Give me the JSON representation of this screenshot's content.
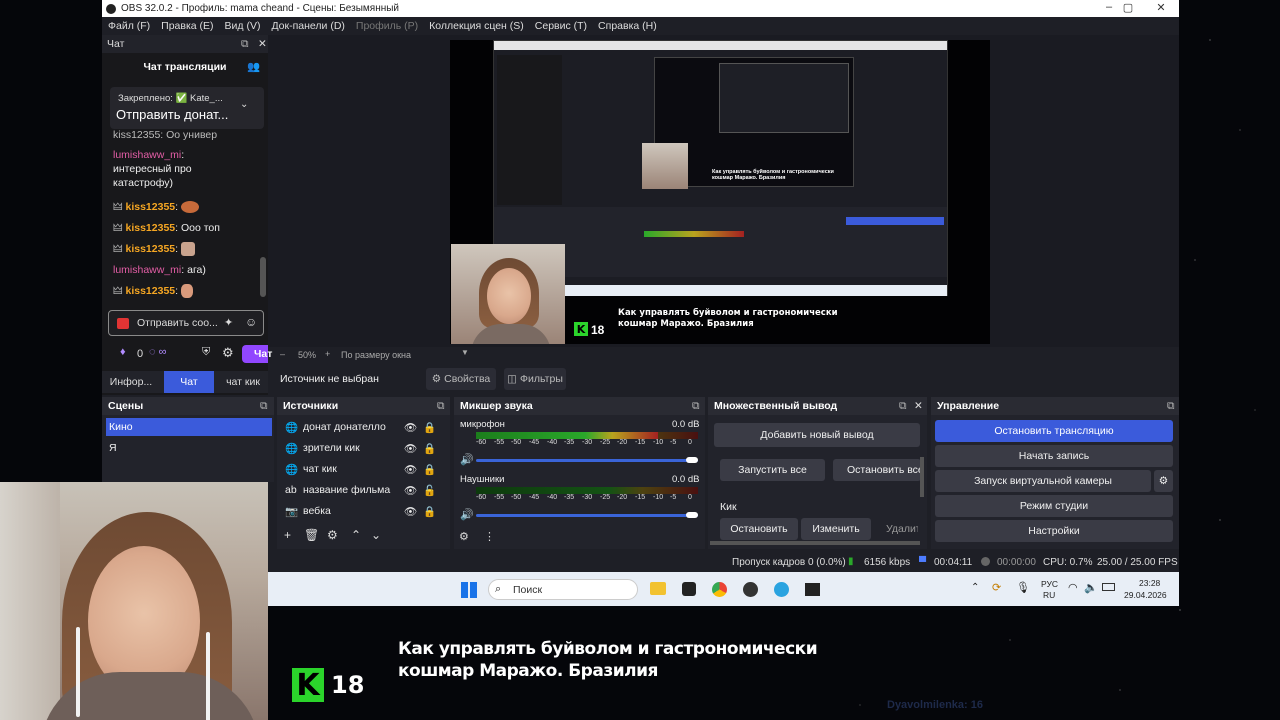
{
  "window": {
    "title": "OBS 32.0.2 - Профиль: mama cheand - Сцены: Безымянный"
  },
  "menu": [
    {
      "label": "Файл (F)",
      "disabled": false
    },
    {
      "label": "Правка (E)",
      "disabled": false
    },
    {
      "label": "Вид (V)",
      "disabled": false
    },
    {
      "label": "Док-панели (D)",
      "disabled": false
    },
    {
      "label": "Профиль (P)",
      "disabled": true
    },
    {
      "label": "Коллекция сцен (S)",
      "disabled": false
    },
    {
      "label": "Сервис (T)",
      "disabled": false
    },
    {
      "label": "Справка (H)",
      "disabled": false
    }
  ],
  "chat": {
    "dock_title": "Чат",
    "header": "Чат трансляции",
    "pinned_label": "Закреплено: ✅ Kate_...",
    "pinned_text": "Отправить донат...",
    "partial_line": "kiss12355: Оо универ",
    "messages": [
      {
        "user": "lumishaww_mi",
        "text": ":",
        "cont1": "интересный про",
        "cont2": "катастрофу)"
      },
      {
        "user": "kiss12355",
        "text": ":"
      },
      {
        "user": "kiss12355",
        "text": ": Ооо топ"
      },
      {
        "user": "kiss12355",
        "text": ":"
      },
      {
        "user": "lumishaww_mi",
        "text": ": ага)"
      },
      {
        "user": "kiss12355",
        "text": ":"
      }
    ],
    "input_placeholder": "Отправить соо...",
    "points": "0",
    "send_label": "Чат",
    "tabs": [
      "Инфор...",
      "Чат",
      "чат кик"
    ]
  },
  "preview": {
    "zoom": "50%",
    "fit_label": "По размеру окна",
    "no_source": "Источник не выбран",
    "properties": "Свойства",
    "filters": "Фильтры"
  },
  "scenes": {
    "title": "Сцены",
    "items": [
      "Кино",
      "Я"
    ]
  },
  "sources": {
    "title": "Источники",
    "items": [
      {
        "name": "донат донателло",
        "icon": "globe-icon"
      },
      {
        "name": "зрители кик",
        "icon": "globe-icon"
      },
      {
        "name": "чат кик",
        "icon": "globe-icon"
      },
      {
        "name": "название фильма",
        "icon": "text-icon"
      },
      {
        "name": "вебка",
        "icon": "camera-icon"
      }
    ]
  },
  "mixer": {
    "title": "Микшер звука",
    "channels": [
      {
        "name": "микрофон",
        "db": "0.0 dB",
        "level": 0.82,
        "volume": 1.0
      },
      {
        "name": "Наушники",
        "db": "0.0 dB",
        "level": 0.0,
        "volume": 1.0
      }
    ],
    "scale": [
      "-60",
      "-55",
      "-50",
      "-45",
      "-40",
      "-35",
      "-30",
      "-25",
      "-20",
      "-15",
      "-10",
      "-5",
      "0"
    ]
  },
  "multi": {
    "title": "Множественный вывод",
    "add": "Добавить новый вывод",
    "start_all": "Запустить все",
    "stop_all": "Остановить все",
    "target": "Кик",
    "stop": "Остановить",
    "edit": "Изменить",
    "delete": "Удалит"
  },
  "controls": {
    "title": "Управление",
    "stop_stream": "Остановить трансляцию",
    "record": "Начать запись",
    "virtual_cam": "Запуск виртуальной камеры",
    "studio": "Режим студии",
    "settings": "Настройки"
  },
  "status": {
    "dropped": "Пропуск кадров 0 (0.0%)",
    "bitrate": "6156 kbps",
    "stream_time": "00:04:11",
    "rec_time": "00:00:00",
    "cpu": "CPU: 0.7%",
    "fps": "25.00 / 25.00 FPS"
  },
  "taskbar": {
    "search": "Поиск",
    "lang1": "РУС",
    "lang2": "RU",
    "time": "23:28",
    "date": "29.04.2026"
  },
  "overlay": {
    "title_line1": "Как управлять буйволом и гастрономически",
    "title_line2": " кошмар Маражо. Бразилия",
    "rating": "18",
    "logo": "K",
    "watermark_user": "Dyavolmilenka:",
    "watermark_count": "16"
  },
  "colors": {
    "accent": "#3b5bdb",
    "kick_green": "#2bd42b",
    "twitch_purple": "#9147ff"
  }
}
